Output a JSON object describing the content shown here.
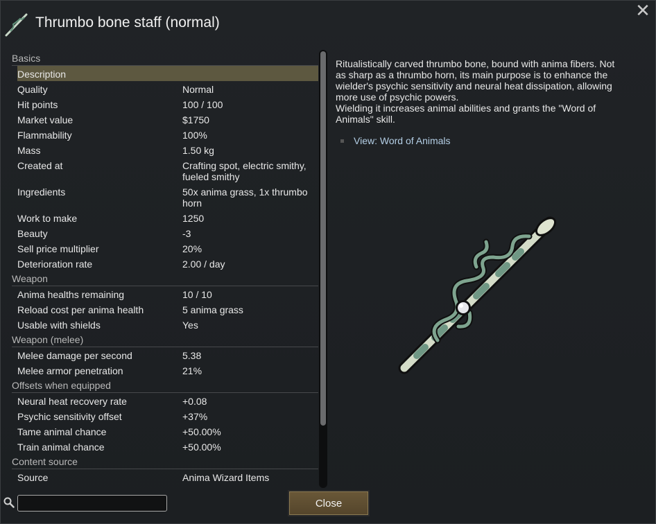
{
  "window": {
    "title": "Thrumbo bone staff (normal)",
    "icon": "staff-icon",
    "close_icon": "close-x-icon"
  },
  "stats": {
    "basics": {
      "header": "Basics",
      "rows": [
        {
          "k": "Description",
          "v": ""
        },
        {
          "k": "Quality",
          "v": "Normal"
        },
        {
          "k": "Hit points",
          "v": "100 / 100"
        },
        {
          "k": "Market value",
          "v": "$1750"
        },
        {
          "k": "Flammability",
          "v": "100%"
        },
        {
          "k": "Mass",
          "v": "1.50 kg"
        },
        {
          "k": "Created at",
          "v": "Crafting spot, electric smithy, fueled smithy"
        },
        {
          "k": "Ingredients",
          "v": "50x anima grass, 1x thrumbo horn"
        },
        {
          "k": "Work to make",
          "v": "1250"
        },
        {
          "k": "Beauty",
          "v": "-3"
        },
        {
          "k": "Sell price multiplier",
          "v": "20%"
        },
        {
          "k": "Deterioration rate",
          "v": "2.00 / day"
        }
      ]
    },
    "weapon": {
      "header": "Weapon",
      "rows": [
        {
          "k": "Anima healths remaining",
          "v": "10 / 10"
        },
        {
          "k": "Reload cost per anima health",
          "v": "5 anima grass"
        },
        {
          "k": "Usable with shields",
          "v": "Yes"
        }
      ]
    },
    "melee": {
      "header": "Weapon (melee)",
      "rows": [
        {
          "k": "Melee damage per second",
          "v": "5.38"
        },
        {
          "k": "Melee armor penetration",
          "v": "21%"
        }
      ]
    },
    "offsets": {
      "header": "Offsets when equipped",
      "rows": [
        {
          "k": "Neural heat recovery rate",
          "v": "+0.08"
        },
        {
          "k": "Psychic sensitivity offset",
          "v": "+37%"
        },
        {
          "k": "Tame animal chance",
          "v": "+50.00%"
        },
        {
          "k": "Train animal chance",
          "v": "+50.00%"
        }
      ]
    },
    "content": {
      "header": "Content source",
      "rows": [
        {
          "k": "Source",
          "v": "Anima Wizard Items"
        }
      ]
    }
  },
  "description": "Ritualistically carved thrumbo bone, bound with anima fibers. Not as sharp as a thrumbo horn, its main purpose is to enhance the wielder's psychic sensitivity and neural heat dissipation, allowing more use of psychic powers.\nWielding it increases animal abilities and grants the \"Word of Animals\" skill.",
  "link": "View: Word of Animals",
  "search": {
    "value": "",
    "icon": "search-icon"
  },
  "buttons": {
    "close": "Close"
  },
  "colors": {
    "selected_row": "#5d5840",
    "link": "#b4cfe6",
    "close_button": "#5e4e31"
  }
}
